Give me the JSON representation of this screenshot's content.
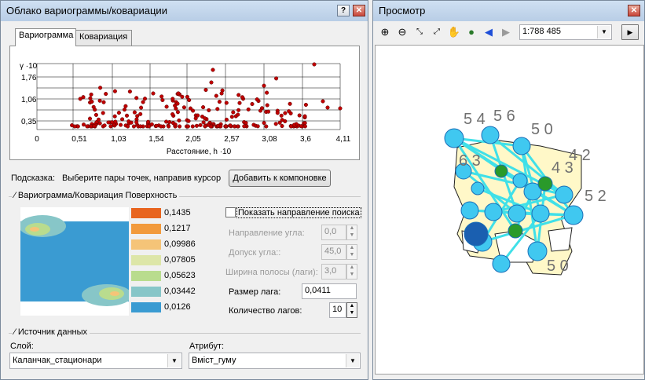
{
  "left_window": {
    "title": "Облако вариограммы/ковариации",
    "tabs": [
      "Вариограмма",
      "Ковариация"
    ],
    "chart": {
      "y_symbol": "γ ·10",
      "y_ticks": [
        "1,76",
        "1,06",
        "0,35"
      ],
      "x_ticks": [
        "0",
        "0,51",
        "1,03",
        "1,54",
        "2,05",
        "2,57",
        "3,08",
        "3,6",
        "4,11"
      ],
      "xlabel": "Расстояние, h ·10"
    },
    "hint_label": "Подсказка:",
    "hint_text": "Выберите пары точек, направив курсор",
    "add_button": "Добавить к компоновке",
    "surface_group": "Вариограмма/Ковариация Поверхность",
    "legend": [
      {
        "label": "0,1435",
        "color": "#e8641e"
      },
      {
        "label": "0,1217",
        "color": "#f29a3c"
      },
      {
        "label": "0,09986",
        "color": "#f5c478"
      },
      {
        "label": "0,07805",
        "color": "#dde6a8"
      },
      {
        "label": "0,05623",
        "color": "#b9dc8e"
      },
      {
        "label": "0,03442",
        "color": "#87c6c8"
      },
      {
        "label": "0,0126",
        "color": "#3a9bd2"
      }
    ],
    "show_direction_label": "Показать направление поиска",
    "angle_dir_label": "Направление угла:",
    "angle_dir_value": "0,0",
    "angle_tol_label": "Допуск угла::",
    "angle_tol_value": "45,0",
    "bandwidth_label": "Ширина полосы (лаги):",
    "bandwidth_value": "3,0",
    "lag_size_label": "Размер лага:",
    "lag_size_value": "0,0411",
    "lag_count_label": "Количество лагов:",
    "lag_count_value": "10",
    "data_source_group": "Источник данных",
    "layer_label": "Слой:",
    "layer_value": "Каланчак_стационари",
    "attribute_label": "Атрибут:",
    "attribute_value": "Вміст_гуму"
  },
  "right_window": {
    "title": "Просмотр",
    "scale": "1:788 485",
    "map_labels": [
      "5 4",
      "5 6",
      "5 0",
      "4 2",
      "5 2",
      "5 0",
      "4 3",
      "6 3"
    ]
  }
}
